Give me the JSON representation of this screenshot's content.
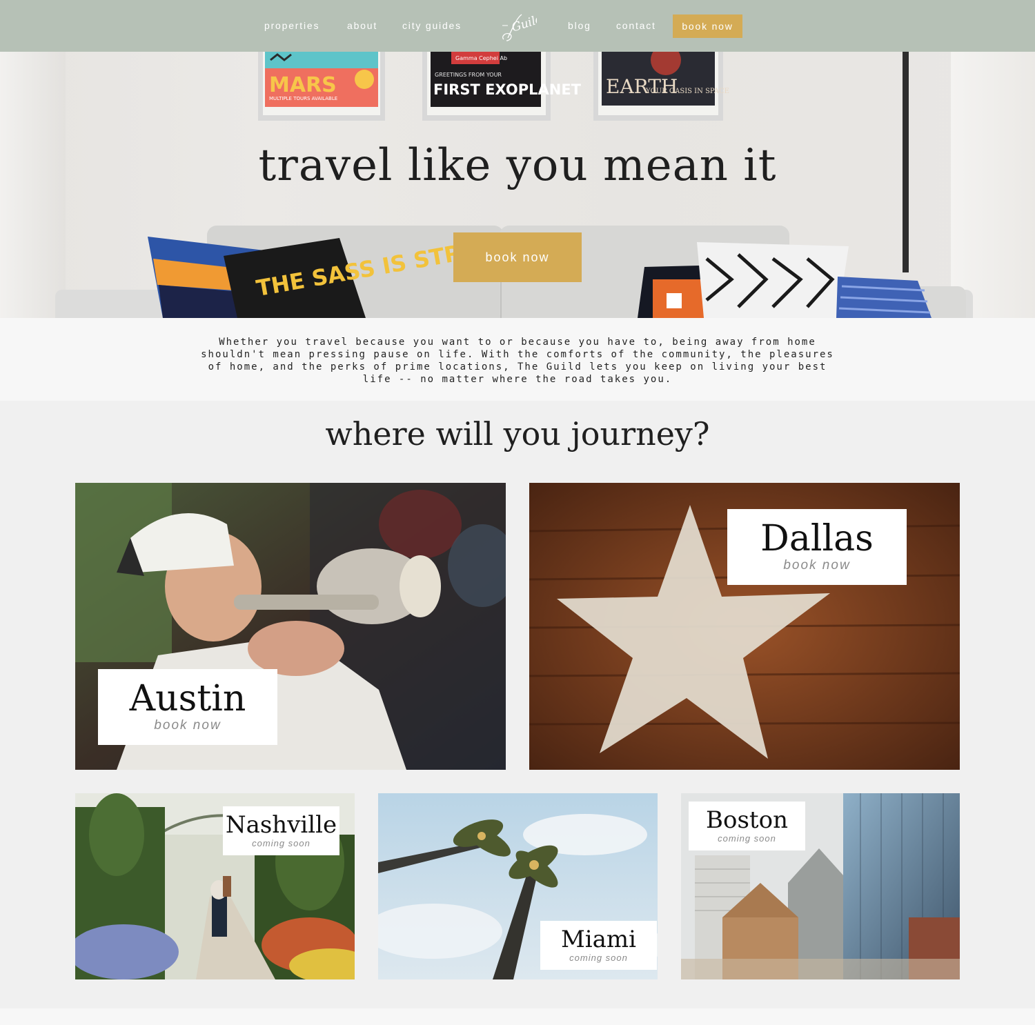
{
  "nav": {
    "items": [
      "properties",
      "about",
      "city guides",
      "blog",
      "contact"
    ],
    "logo_text": "Guild",
    "cta": "book now"
  },
  "hero": {
    "posters": [
      {
        "title": "MARS",
        "subtitle": "MULTIPLE TOURS AVAILABLE"
      },
      {
        "title": "FIRST EXOPLANET",
        "subtitle": "GREETINGS FROM YOUR",
        "top": "Gamma Cephei Ab"
      },
      {
        "title": "EARTH",
        "subtitle": "YOUR OASIS IN SPACE"
      }
    ],
    "pillow_text": "THE SASS IS STRONG",
    "headline": "travel like you mean it",
    "button": "book now"
  },
  "intro": {
    "text": "Whether you travel because you want to or because you have to, being away from home shouldn't mean pressing pause on life. With the comforts of the community, the pleasures of home, and the perks of prime locations, The Guild lets you keep on living your best life -- no matter where the road takes you."
  },
  "journey": {
    "title": "where will you journey?",
    "cities": [
      {
        "name": "Austin",
        "status": "book now"
      },
      {
        "name": "Dallas",
        "status": "book now"
      },
      {
        "name": "Nashville",
        "status": "coming soon"
      },
      {
        "name": "Miami",
        "status": "coming soon"
      },
      {
        "name": "Boston",
        "status": "coming soon"
      }
    ]
  },
  "colors": {
    "nav_bg": "#b6c1b6",
    "accent": "#d4ab55",
    "page_bg": "#f0f0f0",
    "intro_bg": "#f7f7f7"
  }
}
